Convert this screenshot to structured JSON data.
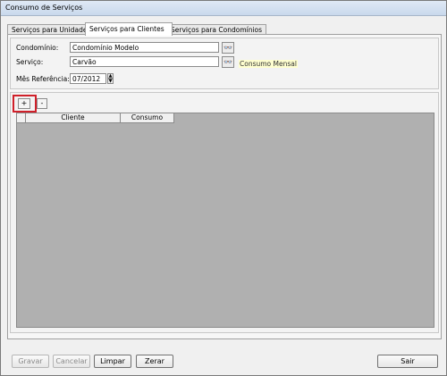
{
  "window": {
    "title": "Consumo de Serviços"
  },
  "tabs": [
    {
      "label": "Serviços para Unidades"
    },
    {
      "label": "Serviços para Clientes"
    },
    {
      "label": "Serviços para Condomínios"
    }
  ],
  "form": {
    "condominio_label": "Condomínio:",
    "condominio_value": "Condomínio Modelo",
    "servico_label": "Serviço:",
    "servico_value": "Carvão",
    "servico_hint": "Consumo Mensal",
    "mes_label": "Mês Referência:",
    "mes_value": "07/2012"
  },
  "grid": {
    "add_label": "+",
    "remove_label": "-",
    "columns": [
      "Cliente",
      "Consumo"
    ]
  },
  "footer": {
    "gravar": "Gravar",
    "cancelar": "Cancelar",
    "limpar": "Limpar",
    "zerar": "Zerar",
    "sair": "Sair"
  },
  "icons": {
    "lookup": "binoculars-icon",
    "spin_up": "spin-up-icon",
    "spin_down": "spin-down-icon"
  },
  "colors": {
    "highlight": "#d0202a",
    "grid_background": "#b0b0b0",
    "hint_background": "#ffffd0"
  }
}
